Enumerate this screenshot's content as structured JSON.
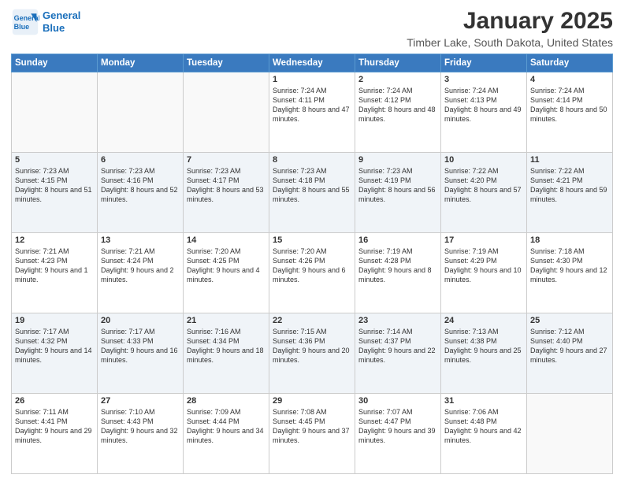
{
  "logo": {
    "line1": "General",
    "line2": "Blue"
  },
  "header": {
    "month": "January 2025",
    "location": "Timber Lake, South Dakota, United States"
  },
  "weekdays": [
    "Sunday",
    "Monday",
    "Tuesday",
    "Wednesday",
    "Thursday",
    "Friday",
    "Saturday"
  ],
  "weeks": [
    [
      {
        "day": "",
        "info": ""
      },
      {
        "day": "",
        "info": ""
      },
      {
        "day": "",
        "info": ""
      },
      {
        "day": "1",
        "info": "Sunrise: 7:24 AM\nSunset: 4:11 PM\nDaylight: 8 hours and 47 minutes."
      },
      {
        "day": "2",
        "info": "Sunrise: 7:24 AM\nSunset: 4:12 PM\nDaylight: 8 hours and 48 minutes."
      },
      {
        "day": "3",
        "info": "Sunrise: 7:24 AM\nSunset: 4:13 PM\nDaylight: 8 hours and 49 minutes."
      },
      {
        "day": "4",
        "info": "Sunrise: 7:24 AM\nSunset: 4:14 PM\nDaylight: 8 hours and 50 minutes."
      }
    ],
    [
      {
        "day": "5",
        "info": "Sunrise: 7:23 AM\nSunset: 4:15 PM\nDaylight: 8 hours and 51 minutes."
      },
      {
        "day": "6",
        "info": "Sunrise: 7:23 AM\nSunset: 4:16 PM\nDaylight: 8 hours and 52 minutes."
      },
      {
        "day": "7",
        "info": "Sunrise: 7:23 AM\nSunset: 4:17 PM\nDaylight: 8 hours and 53 minutes."
      },
      {
        "day": "8",
        "info": "Sunrise: 7:23 AM\nSunset: 4:18 PM\nDaylight: 8 hours and 55 minutes."
      },
      {
        "day": "9",
        "info": "Sunrise: 7:23 AM\nSunset: 4:19 PM\nDaylight: 8 hours and 56 minutes."
      },
      {
        "day": "10",
        "info": "Sunrise: 7:22 AM\nSunset: 4:20 PM\nDaylight: 8 hours and 57 minutes."
      },
      {
        "day": "11",
        "info": "Sunrise: 7:22 AM\nSunset: 4:21 PM\nDaylight: 8 hours and 59 minutes."
      }
    ],
    [
      {
        "day": "12",
        "info": "Sunrise: 7:21 AM\nSunset: 4:23 PM\nDaylight: 9 hours and 1 minute."
      },
      {
        "day": "13",
        "info": "Sunrise: 7:21 AM\nSunset: 4:24 PM\nDaylight: 9 hours and 2 minutes."
      },
      {
        "day": "14",
        "info": "Sunrise: 7:20 AM\nSunset: 4:25 PM\nDaylight: 9 hours and 4 minutes."
      },
      {
        "day": "15",
        "info": "Sunrise: 7:20 AM\nSunset: 4:26 PM\nDaylight: 9 hours and 6 minutes."
      },
      {
        "day": "16",
        "info": "Sunrise: 7:19 AM\nSunset: 4:28 PM\nDaylight: 9 hours and 8 minutes."
      },
      {
        "day": "17",
        "info": "Sunrise: 7:19 AM\nSunset: 4:29 PM\nDaylight: 9 hours and 10 minutes."
      },
      {
        "day": "18",
        "info": "Sunrise: 7:18 AM\nSunset: 4:30 PM\nDaylight: 9 hours and 12 minutes."
      }
    ],
    [
      {
        "day": "19",
        "info": "Sunrise: 7:17 AM\nSunset: 4:32 PM\nDaylight: 9 hours and 14 minutes."
      },
      {
        "day": "20",
        "info": "Sunrise: 7:17 AM\nSunset: 4:33 PM\nDaylight: 9 hours and 16 minutes."
      },
      {
        "day": "21",
        "info": "Sunrise: 7:16 AM\nSunset: 4:34 PM\nDaylight: 9 hours and 18 minutes."
      },
      {
        "day": "22",
        "info": "Sunrise: 7:15 AM\nSunset: 4:36 PM\nDaylight: 9 hours and 20 minutes."
      },
      {
        "day": "23",
        "info": "Sunrise: 7:14 AM\nSunset: 4:37 PM\nDaylight: 9 hours and 22 minutes."
      },
      {
        "day": "24",
        "info": "Sunrise: 7:13 AM\nSunset: 4:38 PM\nDaylight: 9 hours and 25 minutes."
      },
      {
        "day": "25",
        "info": "Sunrise: 7:12 AM\nSunset: 4:40 PM\nDaylight: 9 hours and 27 minutes."
      }
    ],
    [
      {
        "day": "26",
        "info": "Sunrise: 7:11 AM\nSunset: 4:41 PM\nDaylight: 9 hours and 29 minutes."
      },
      {
        "day": "27",
        "info": "Sunrise: 7:10 AM\nSunset: 4:43 PM\nDaylight: 9 hours and 32 minutes."
      },
      {
        "day": "28",
        "info": "Sunrise: 7:09 AM\nSunset: 4:44 PM\nDaylight: 9 hours and 34 minutes."
      },
      {
        "day": "29",
        "info": "Sunrise: 7:08 AM\nSunset: 4:45 PM\nDaylight: 9 hours and 37 minutes."
      },
      {
        "day": "30",
        "info": "Sunrise: 7:07 AM\nSunset: 4:47 PM\nDaylight: 9 hours and 39 minutes."
      },
      {
        "day": "31",
        "info": "Sunrise: 7:06 AM\nSunset: 4:48 PM\nDaylight: 9 hours and 42 minutes."
      },
      {
        "day": "",
        "info": ""
      }
    ]
  ]
}
